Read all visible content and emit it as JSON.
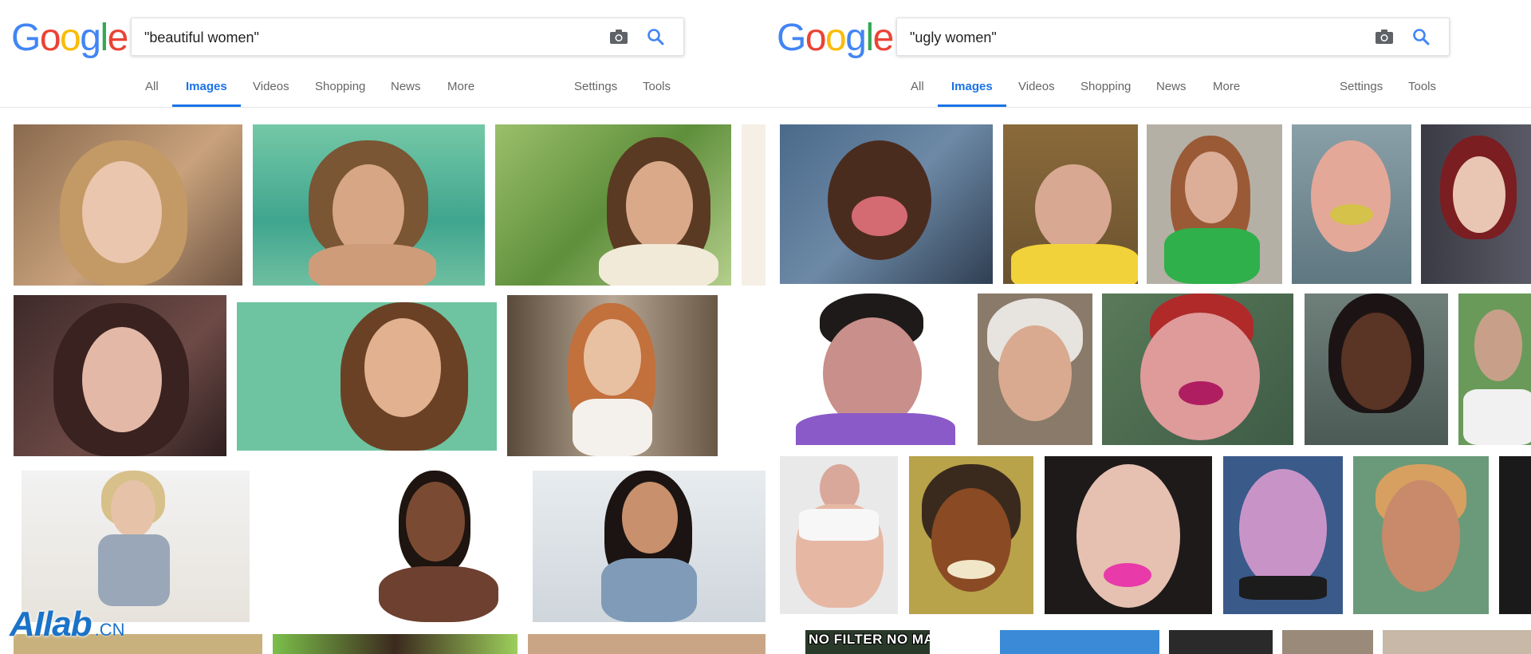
{
  "left": {
    "logo": "Google",
    "query": "\"beautiful women\"",
    "tabs": {
      "all": "All",
      "images": "Images",
      "videos": "Videos",
      "shopping": "Shopping",
      "news": "News",
      "more": "More",
      "settings": "Settings",
      "tools": "Tools"
    },
    "active_tab": "Images"
  },
  "right": {
    "logo": "Google",
    "query": "\"ugly women\"",
    "tabs": {
      "all": "All",
      "images": "Images",
      "videos": "Videos",
      "shopping": "Shopping",
      "news": "News",
      "more": "More",
      "settings": "Settings",
      "tools": "Tools"
    },
    "active_tab": "Images",
    "banner_text": "NO FILTER NO MAKEUP"
  },
  "watermark": {
    "main": "AIlab",
    "suffix": ".CN"
  },
  "colors": {
    "accent": "#1a73e8",
    "logo_blue": "#4285F4",
    "logo_red": "#EA4335",
    "logo_yellow": "#FBBC05",
    "logo_green": "#34A853"
  },
  "icons": {
    "camera": "camera-icon",
    "search": "search-icon"
  }
}
